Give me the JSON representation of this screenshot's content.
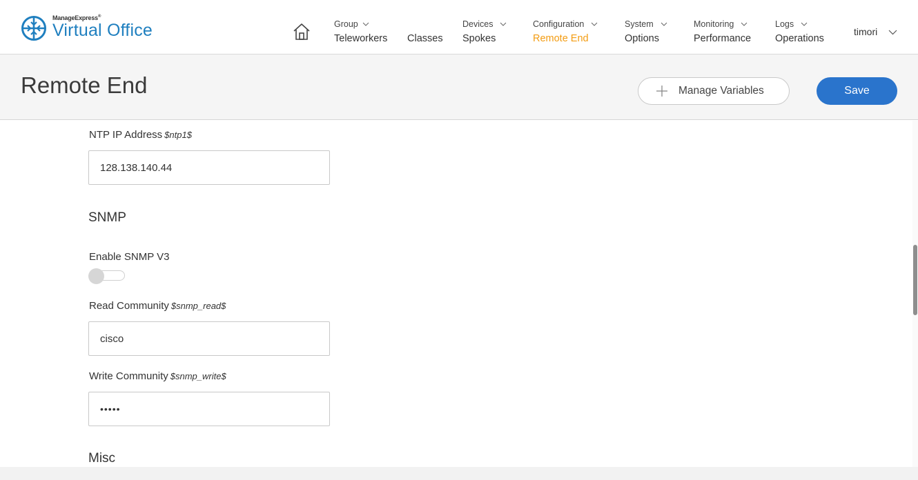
{
  "brand": {
    "small": "ManageExpress",
    "small_mark": "®",
    "big": "Virtual Office"
  },
  "nav": {
    "home_icon": "home-icon",
    "items": [
      {
        "top": "Group",
        "main": "Teleworkers"
      },
      {
        "top": "",
        "main": "Classes"
      },
      {
        "top": "Devices",
        "main": "Spokes"
      },
      {
        "top": "Configuration",
        "main": "Remote End"
      },
      {
        "top": "System",
        "main": "Options"
      },
      {
        "top": "Monitoring",
        "main": "Performance"
      },
      {
        "top": "Logs",
        "main": "Operations"
      }
    ],
    "active_color": "#f39c12",
    "user": "timori"
  },
  "page": {
    "title": "Remote End",
    "manage_label": "Manage Variables",
    "save_label": "Save",
    "save_color": "#2a74cc"
  },
  "form": {
    "ntp_label": "NTP IP Address",
    "ntp_var": "$ntp1$",
    "ntp_value": "128.138.140.44",
    "snmp_section": "SNMP",
    "enable_snmp_label": "Enable SNMP V3",
    "enable_snmp_on": false,
    "read_label": "Read Community",
    "read_var": "$snmp_read$",
    "read_value": "cisco",
    "write_label": "Write Community",
    "write_var": "$snmp_write$",
    "write_value": "•••••",
    "misc_section": "Misc"
  }
}
